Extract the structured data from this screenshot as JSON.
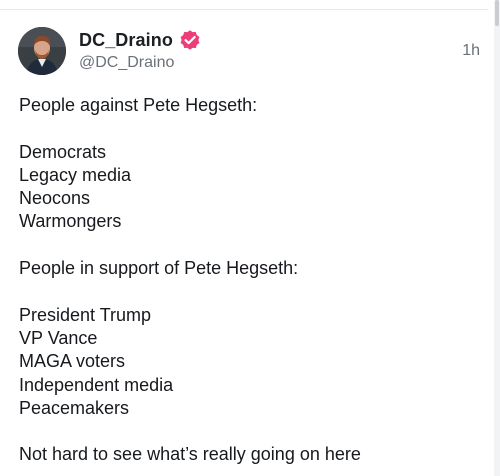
{
  "post": {
    "author": {
      "display_name": "DC_Draino",
      "handle": "@DC_Draino",
      "verified_icon": "verified-badge-icon",
      "verified_color": "#ee3e7a"
    },
    "timestamp": "1h",
    "paragraphs": [
      {
        "lines": [
          "People against Pete Hegseth:"
        ]
      },
      {
        "lines": [
          "Democrats",
          "Legacy media",
          "Neocons",
          "Warmongers"
        ]
      },
      {
        "lines": [
          "People in support of Pete Hegseth:"
        ]
      },
      {
        "lines": [
          "President Trump",
          "VP Vance",
          "MAGA voters",
          "Independent media",
          "Peacemakers"
        ]
      },
      {
        "lines": [
          "Not hard to see what’s really going on here"
        ]
      }
    ]
  }
}
